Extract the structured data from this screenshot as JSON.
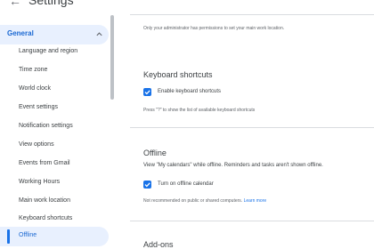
{
  "header": {
    "title": "Settings",
    "back_icon": "arrow-back-icon",
    "apps_icon": "apps-grid-icon"
  },
  "sidebar": {
    "section": "General",
    "items": [
      "Language and region",
      "Time zone",
      "World clock",
      "Event settings",
      "Notification settings",
      "View options",
      "Events from Gmail",
      "Working Hours",
      "Main work location",
      "Keyboard shortcuts",
      "Offline"
    ],
    "selected": "Offline"
  },
  "main": {
    "location_note": "Only your administrator has permissions to set your main work location.",
    "keyboard": {
      "title": "Keyboard shortcuts",
      "checkbox_label": "Enable keyboard shortcuts",
      "checked": true,
      "help": "Press \"?\" to show the list of available keyboard shortcuts"
    },
    "offline": {
      "title": "Offline",
      "description": "View \"My calendars\" while offline. Reminders and tasks aren't shown offline.",
      "checkbox_label": "Turn on offline calendar",
      "checked": true,
      "note": "Not recommended on public or shared computers.",
      "link": "Learn more"
    },
    "addons": {
      "title": "Add-ons"
    }
  },
  "colors": {
    "accent": "#1a73e8",
    "selected_bg": "#e8f0fe",
    "text": "#3c4043"
  }
}
